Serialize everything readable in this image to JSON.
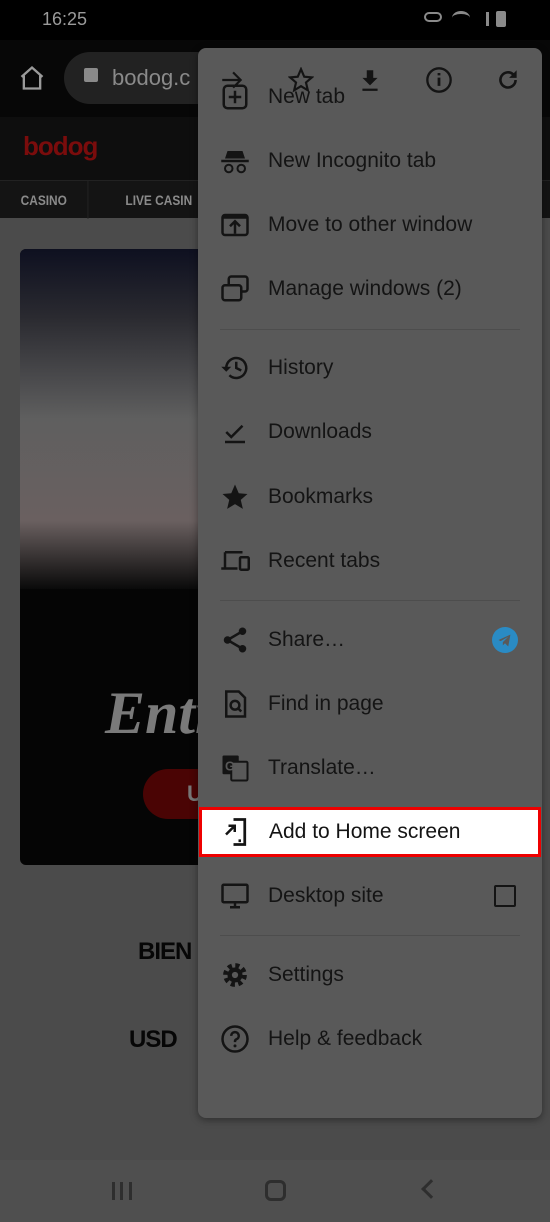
{
  "status_bar": {
    "time": "16:25"
  },
  "toolbar": {
    "url": "bodog.c"
  },
  "site": {
    "logo": "bodog",
    "nav": [
      "CASINO",
      "LIVE CASIN"
    ],
    "banner_text": "Entr",
    "button_text": "U",
    "welcome": "BIEN",
    "currency": "USD"
  },
  "menu": {
    "top_icons": [
      "forward-icon",
      "bookmark-star-icon",
      "download-icon",
      "info-icon",
      "refresh-icon"
    ],
    "items": [
      {
        "label": "New tab",
        "icon": "new-tab-icon"
      },
      {
        "label": "New Incognito tab",
        "icon": "incognito-icon"
      },
      {
        "label": "Move to other window",
        "icon": "move-window-icon"
      },
      {
        "label": "Manage windows (2)",
        "icon": "manage-windows-icon"
      },
      {
        "label": "History",
        "icon": "history-icon"
      },
      {
        "label": "Downloads",
        "icon": "downloads-icon"
      },
      {
        "label": "Bookmarks",
        "icon": "bookmarks-icon"
      },
      {
        "label": "Recent tabs",
        "icon": "recent-tabs-icon"
      },
      {
        "label": "Share…",
        "icon": "share-icon"
      },
      {
        "label": "Find in page",
        "icon": "find-in-page-icon"
      },
      {
        "label": "Translate…",
        "icon": "translate-icon"
      },
      {
        "label": "Add to Home screen",
        "icon": "add-to-home-icon",
        "highlighted": true
      },
      {
        "label": "Desktop site",
        "icon": "desktop-icon",
        "checked": false
      },
      {
        "label": "Settings",
        "icon": "settings-icon"
      },
      {
        "label": "Help & feedback",
        "icon": "help-icon"
      }
    ]
  },
  "colors": {
    "highlight_border": "#ee0000",
    "telegram": "#2a8bc4",
    "brand": "#7a0c0c"
  }
}
